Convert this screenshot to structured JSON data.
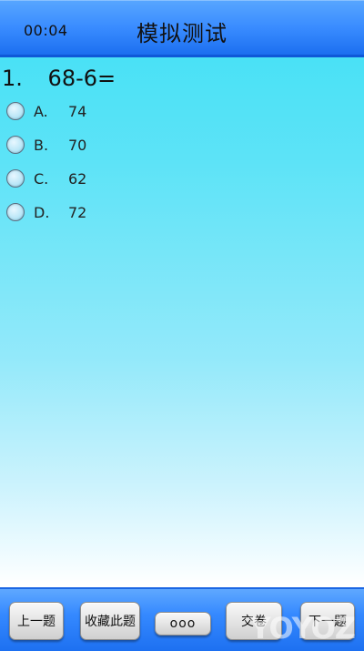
{
  "header": {
    "timer": "00:04",
    "title": "模拟测试"
  },
  "question": {
    "number": "1.",
    "text": "68-6="
  },
  "options": [
    {
      "letter": "A.",
      "value": "74"
    },
    {
      "letter": "B.",
      "value": "70"
    },
    {
      "letter": "C.",
      "value": "62"
    },
    {
      "letter": "D.",
      "value": "72"
    }
  ],
  "toolbar": {
    "prev_label": "上一题",
    "fav_label": "收藏此题",
    "more_label": "ooo",
    "submit_label": "交卷",
    "next_label": "下一题"
  },
  "watermark": "YOYOZ"
}
